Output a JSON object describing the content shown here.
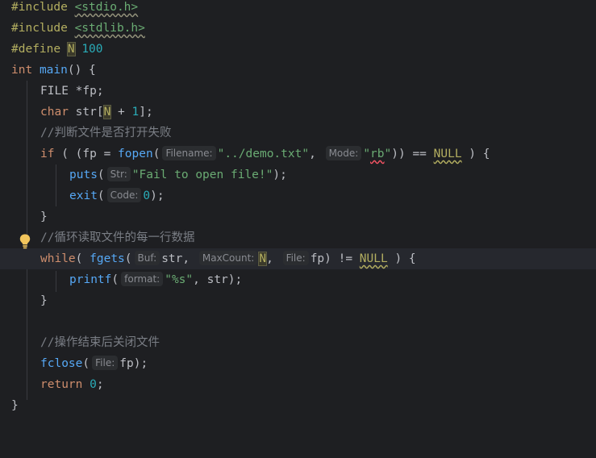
{
  "code": {
    "l1": {
      "kw": "#include",
      "path": "<stdio.h>"
    },
    "l2": {
      "kw": "#include",
      "path": "<stdlib.h>"
    },
    "l3": {
      "kw": "#define",
      "name": "N",
      "value": "100"
    },
    "l4": {
      "type": "int",
      "name": "main",
      "rest": "() {"
    },
    "l5": {
      "text": "FILE *fp;"
    },
    "l6": {
      "type": "char",
      "a": " str[",
      "n": "N",
      "b": " + ",
      "one": "1",
      "c": "];"
    },
    "l7": {
      "comment": "//判断文件是否打开失败"
    },
    "l8": {
      "kw": "if",
      "a": " ( (fp = ",
      "fn": "fopen",
      "b": "(",
      "hint1": "Filename:",
      "s1": "\"../demo.txt\"",
      "c": ", ",
      "hint2": "Mode:",
      "s2q1": "\"",
      "s2": "rb",
      "s2q2": "\"",
      "d": ")) == ",
      "null": "NULL",
      "e": " ) {"
    },
    "l9": {
      "fn": "puts",
      "a": "(",
      "hint": "Str:",
      "s": "\"Fail to open file!\"",
      "b": ");"
    },
    "l10": {
      "fn": "exit",
      "a": "(",
      "hint": "Code:",
      "n": "0",
      "b": ");"
    },
    "l11": {
      "text": "}"
    },
    "l12": {
      "comment": "//循环读取文件的每一行数据"
    },
    "l13": {
      "kw": "while",
      "a": "( ",
      "fn": "fgets",
      "b": "(",
      "hint1": "Buf:",
      "c": "str, ",
      "hint2": "MaxCount:",
      "n": "N",
      "d": ", ",
      "hint3": "File:",
      "e": "fp) != ",
      "null": "NULL",
      "f": " ) {"
    },
    "l14": {
      "fn": "printf",
      "a": "(",
      "hint": "format:",
      "s": "\"%s\"",
      "b": ", str);"
    },
    "l15": {
      "text": "}"
    },
    "l17": {
      "comment": "//操作结束后关闭文件"
    },
    "l18": {
      "fn": "fclose",
      "a": "(",
      "hint": "File:",
      "b": "fp);"
    },
    "l19": {
      "kw": "return",
      "a": " ",
      "n": "0",
      "b": ";"
    },
    "l20": {
      "text": "}"
    }
  },
  "colors": {
    "background": "#1e1f22",
    "keyword": "#cf8e6d",
    "function": "#56a8f5",
    "string": "#6aab73",
    "number": "#2aacb8",
    "comment": "#7a7e85",
    "macro": "#b3ae60",
    "text": "#bcbec4"
  },
  "icons": {
    "gutter": "lightbulb-icon"
  }
}
